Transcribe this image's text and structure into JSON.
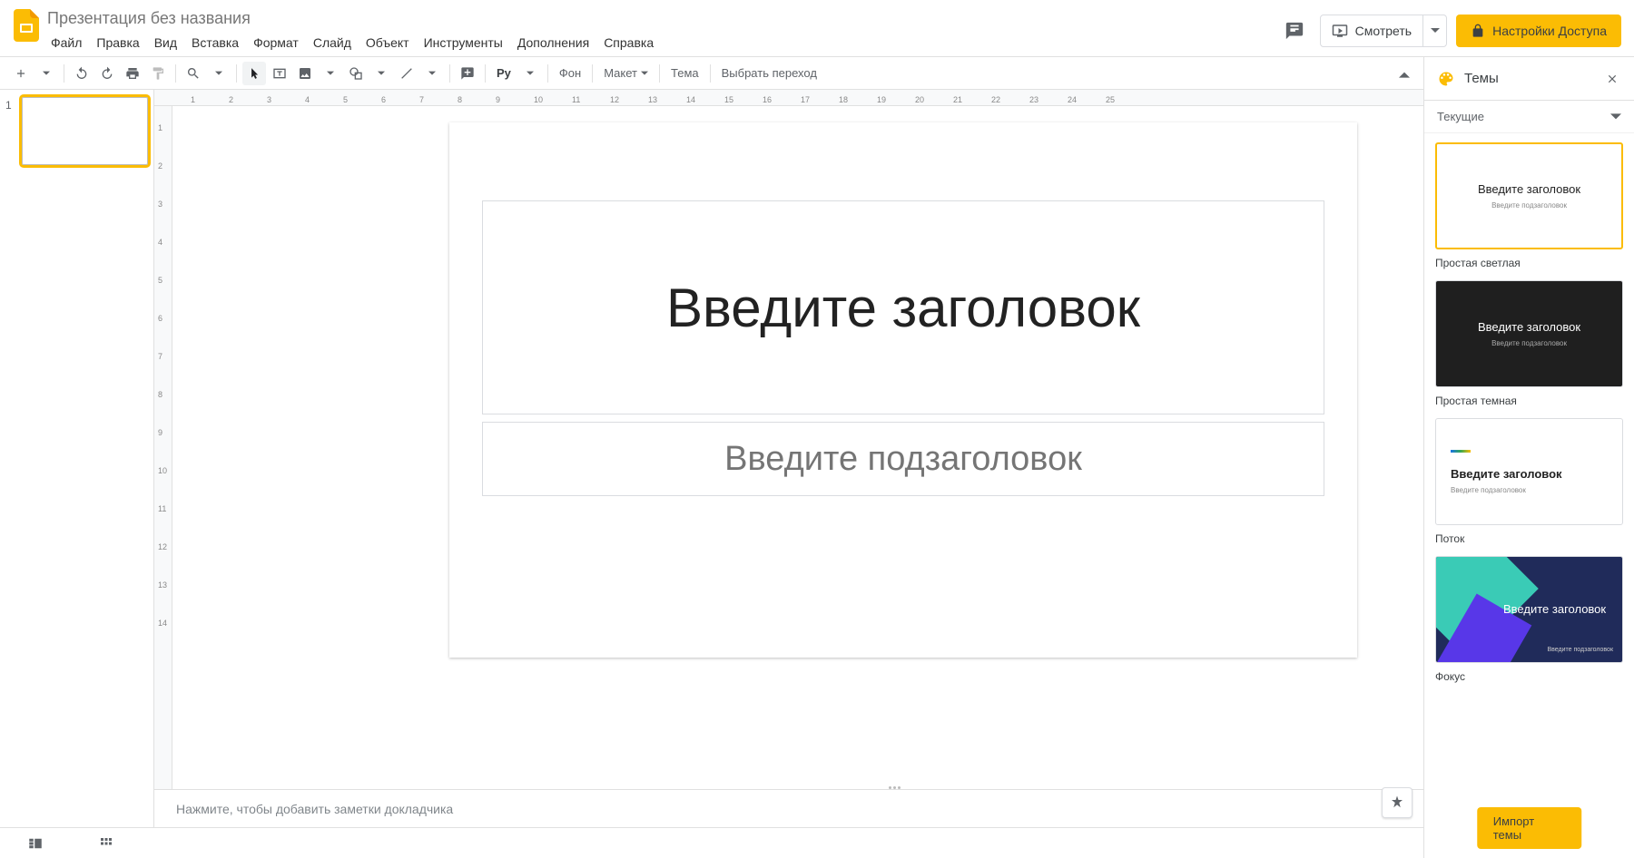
{
  "doc_title": "Презентация без названия",
  "menus": [
    "Файл",
    "Правка",
    "Вид",
    "Вставка",
    "Формат",
    "Слайд",
    "Объект",
    "Инструменты",
    "Дополнения",
    "Справка"
  ],
  "header": {
    "present": "Смотреть",
    "share": "Настройки Доступа"
  },
  "toolbar": {
    "bg": "Фон",
    "layout": "Макет",
    "theme": "Тема",
    "transition": "Выбрать переход",
    "py": "Py"
  },
  "filmstrip": {
    "slide1_num": "1"
  },
  "slide": {
    "title_placeholder": "Введите заголовок",
    "subtitle_placeholder": "Введите подзаголовок"
  },
  "notes_placeholder": "Нажмите, чтобы добавить заметки докладчика",
  "themes_panel": {
    "title": "Темы",
    "section": "Текущие",
    "items": [
      {
        "title": "Введите заголовок",
        "sub": "Введите подзаголовок",
        "label": "Простая светлая"
      },
      {
        "title": "Введите заголовок",
        "sub": "Введите подзаголовок",
        "label": "Простая темная"
      },
      {
        "title": "Введите заголовок",
        "sub": "Введите подзаголовок",
        "label": "Поток"
      },
      {
        "title": "Введите заголовок",
        "sub": "Введите подзаголовок",
        "label": "Фокус"
      }
    ],
    "import": "Импорт темы"
  },
  "ruler_h": [
    "1",
    "2",
    "3",
    "4",
    "5",
    "6",
    "7",
    "8",
    "9",
    "10",
    "11",
    "12",
    "13",
    "14",
    "15",
    "16",
    "17",
    "18",
    "19",
    "20",
    "21",
    "22",
    "23",
    "24",
    "25"
  ],
  "ruler_v": [
    "1",
    "2",
    "3",
    "4",
    "5",
    "6",
    "7",
    "8",
    "9",
    "10",
    "11",
    "12",
    "13",
    "14"
  ]
}
